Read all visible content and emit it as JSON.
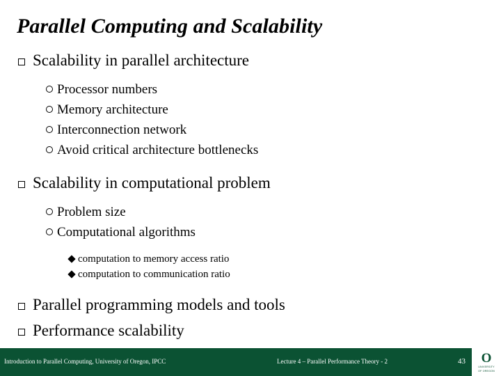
{
  "slide": {
    "title": "Parallel Computing and Scalability",
    "background_color": "#ffffff",
    "text_color": "#000000"
  },
  "bullets": {
    "section1": {
      "label": "Scalability in parallel architecture",
      "marker": "hollow-square",
      "children": [
        {
          "label": "Processor numbers",
          "marker": "hollow-circle"
        },
        {
          "label": "Memory architecture",
          "marker": "hollow-circle"
        },
        {
          "label": "Interconnection network",
          "marker": "hollow-circle"
        },
        {
          "label": "Avoid critical architecture bottlenecks",
          "marker": "hollow-circle"
        }
      ]
    },
    "section2": {
      "label": "Scalability in computational problem",
      "marker": "hollow-square",
      "children": [
        {
          "label": "Problem size",
          "marker": "hollow-circle"
        },
        {
          "label": "Computational algorithms",
          "marker": "hollow-circle",
          "children": [
            {
              "label": "computation to memory access ratio",
              "marker": "filled-diamond"
            },
            {
              "label": "computation to communication ratio",
              "marker": "filled-diamond"
            }
          ]
        }
      ]
    },
    "section3": {
      "label": "Parallel programming models and tools",
      "marker": "hollow-square"
    },
    "section4": {
      "label": "Performance scalability",
      "marker": "hollow-square"
    }
  },
  "footer": {
    "left_text": "Introduction to Parallel Computing, University of Oregon, IPCC",
    "center_text": "Lecture 4 – Parallel Performance Theory - 2",
    "page_number": "43",
    "background_color": "#0b5233",
    "text_color": "#ffffff",
    "logo": {
      "mark": "O",
      "line1": "UNIVERSITY",
      "line2": "OF OREGON",
      "color": "#0b5233"
    }
  }
}
